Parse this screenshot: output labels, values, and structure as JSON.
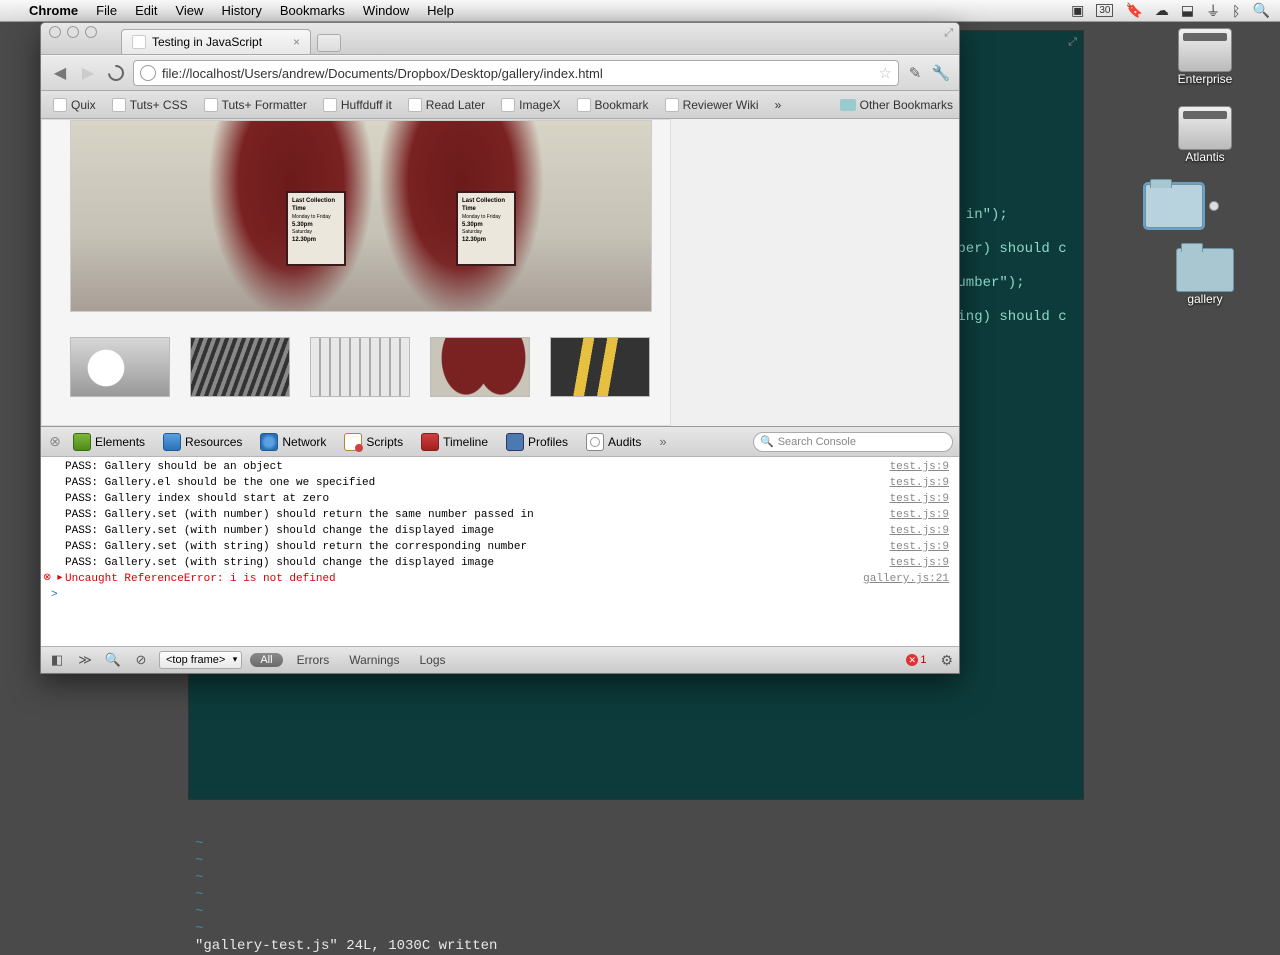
{
  "menubar": {
    "app": "Chrome",
    "items": [
      "File",
      "Edit",
      "View",
      "History",
      "Bookmarks",
      "Window",
      "Help"
    ],
    "right_cal": "30"
  },
  "desktop": {
    "items": [
      {
        "type": "hdd",
        "label": "Enterprise"
      },
      {
        "type": "hdd",
        "label": "Atlantis"
      },
      {
        "type": "folder",
        "label": "",
        "selected": true
      },
      {
        "type": "folder",
        "label": "gallery"
      }
    ]
  },
  "chrome": {
    "tab_title": "Testing in JavaScript",
    "url": "file://localhost/Users/andrew/Documents/Dropbox/Desktop/gallery/index.html",
    "bookmarks": [
      "Quix",
      "Tuts+ CSS",
      "Tuts+ Formatter",
      "Huffduff it",
      "Read Later",
      "ImageX",
      "Bookmark",
      "Reviewer Wiki"
    ],
    "bookmarks_overflow": "»",
    "other_bookmarks": "Other Bookmarks"
  },
  "panel": {
    "title": "Last Collection Time",
    "line1": "Monday to Friday",
    "time1": "5.30pm",
    "line2": "Saturday",
    "time2": "12.30pm"
  },
  "devtools": {
    "tabs": [
      "Elements",
      "Resources",
      "Network",
      "Scripts",
      "Timeline",
      "Profiles",
      "Audits"
    ],
    "search_placeholder": "Search Console",
    "frame": "<top frame>",
    "filters_all": "All",
    "filters": [
      "Errors",
      "Warnings",
      "Logs"
    ],
    "error_count": "1"
  },
  "console": [
    {
      "msg": "PASS: Gallery should be an object",
      "src": "test.js:9"
    },
    {
      "msg": "PASS: Gallery.el should be the one we specified",
      "src": "test.js:9"
    },
    {
      "msg": "PASS: Gallery index should start at zero",
      "src": "test.js:9"
    },
    {
      "msg": "PASS: Gallery.set (with number) should return the same number passed in",
      "src": "test.js:9"
    },
    {
      "msg": "PASS: Gallery.set (with number) should change the displayed image",
      "src": "test.js:9"
    },
    {
      "msg": "PASS: Gallery.set (with string) should return the corresponding number",
      "src": "test.js:9"
    },
    {
      "msg": "PASS: Gallery.set (with string) should change the displayed image",
      "src": "test.js:9"
    },
    {
      "msg": "Uncaught ReferenceError: i is not defined",
      "src": "gallery.js:21",
      "err": true
    }
  ],
  "terminal": {
    "code_lines": [
      "d in\");",
      "mber) should c",
      " number\");",
      "ring) should c"
    ],
    "status": "\"gallery-test.js\" 24L, 1030C written"
  }
}
